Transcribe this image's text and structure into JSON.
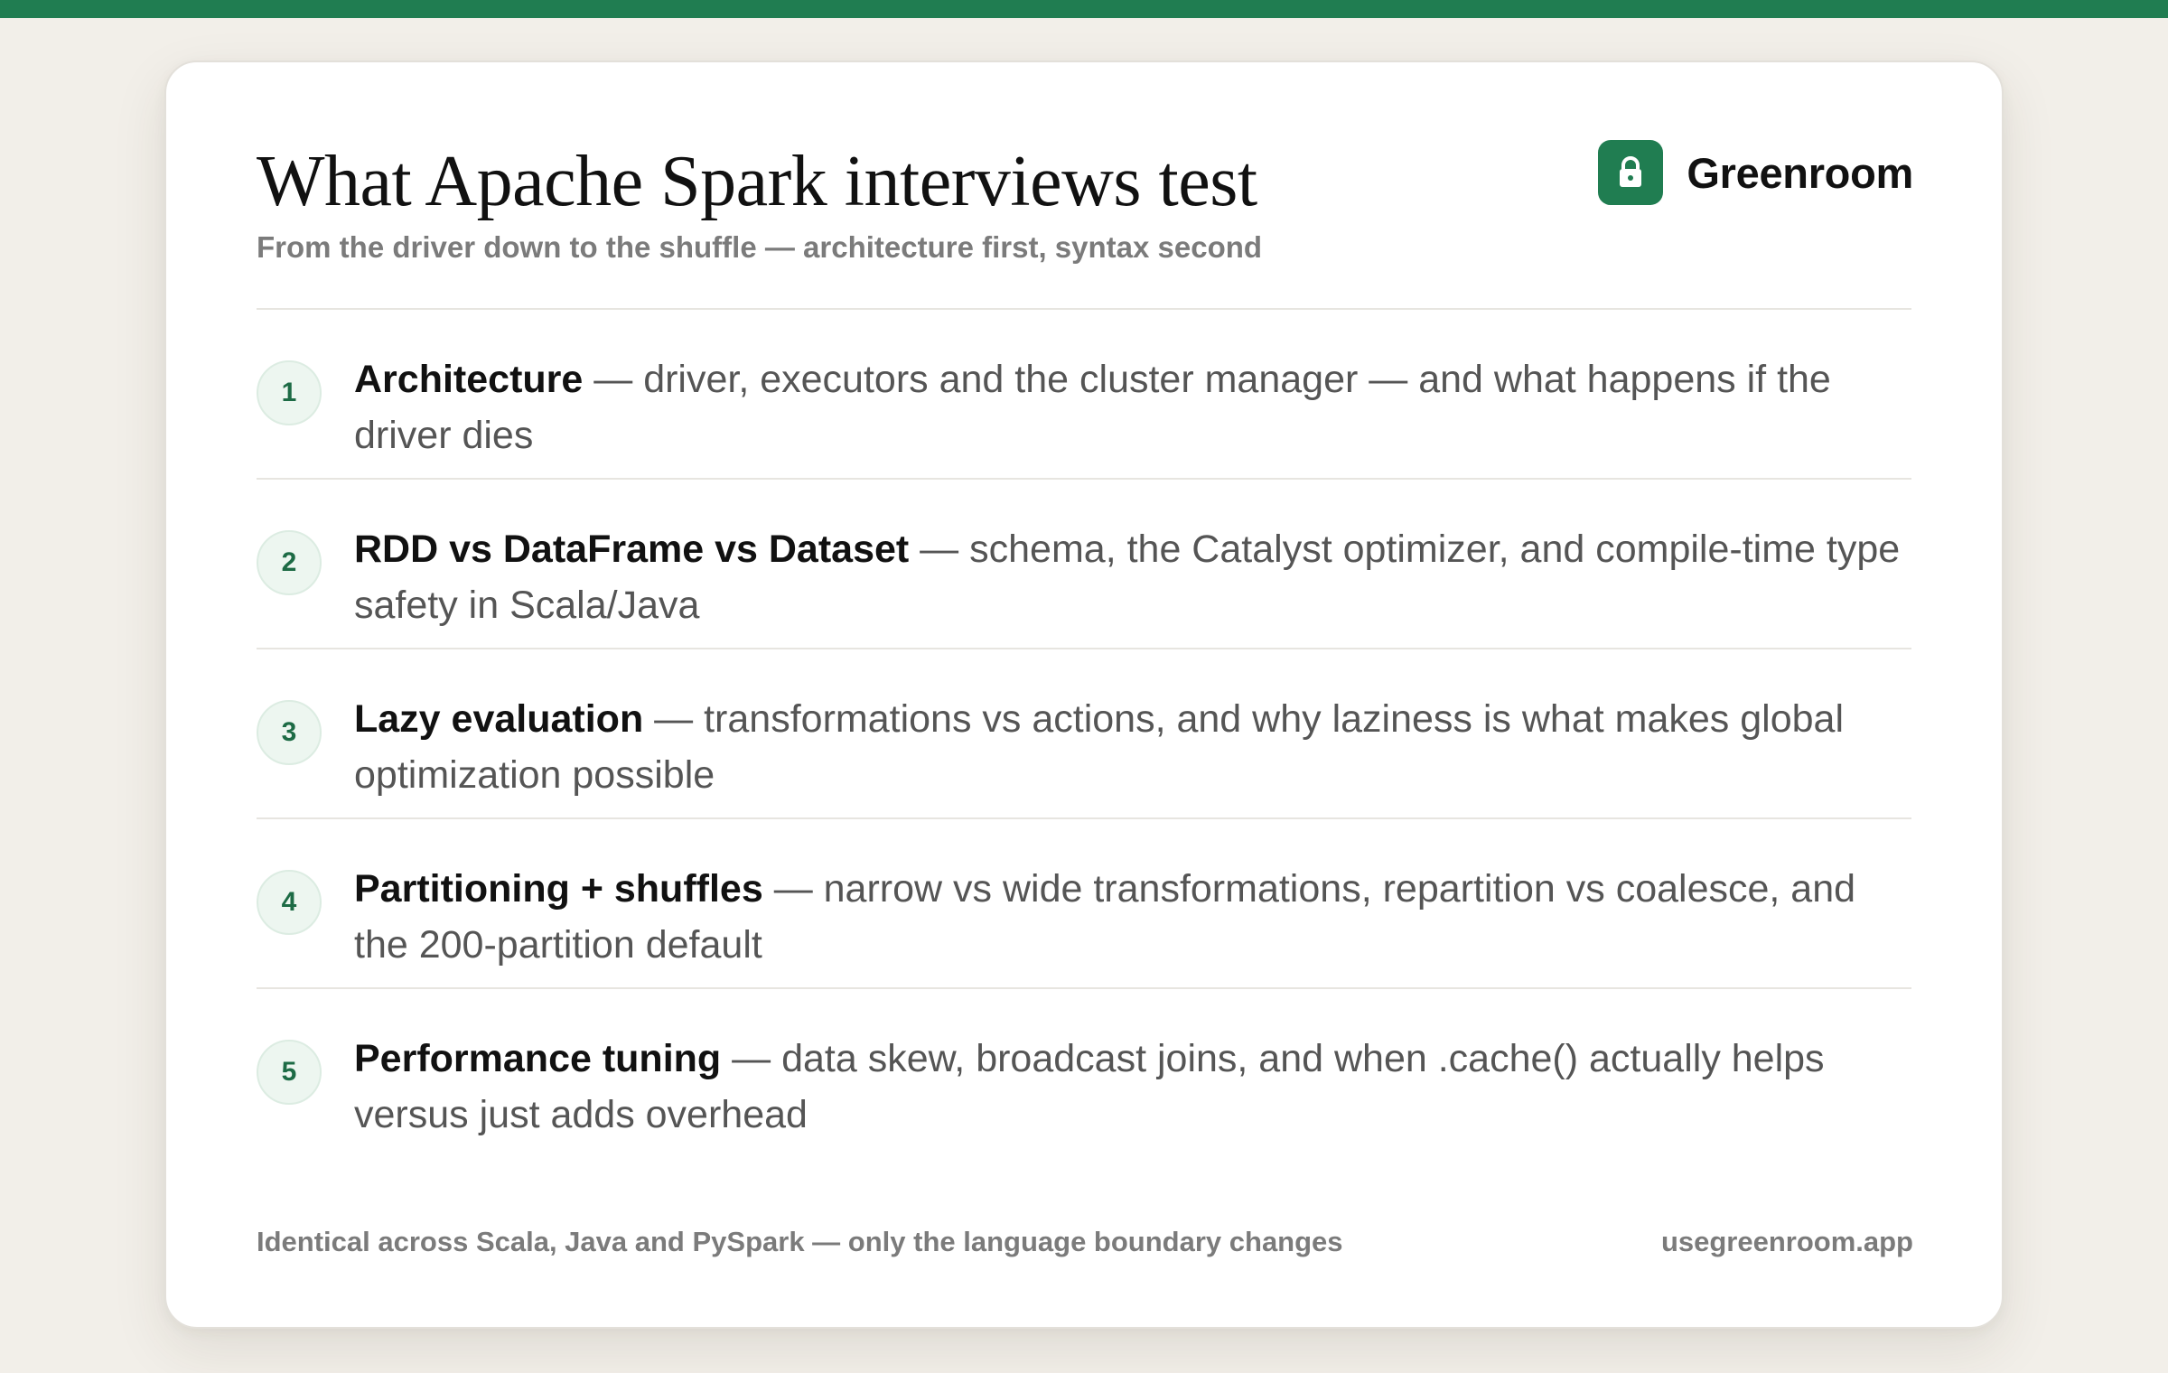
{
  "colors": {
    "accent": "#207d51",
    "background": "#f2efe9",
    "card": "#ffffff",
    "title_text": "#111111",
    "body_text": "#555555",
    "muted_text": "#7b7b7b",
    "badge_background": "#edf6f0",
    "badge_text": "#1d6b45"
  },
  "header": {
    "title": "What Apache Spark interviews test",
    "subtitle": "From the driver down to the shuffle — architecture first, syntax second"
  },
  "brand": {
    "name": "Greenroom",
    "icon": "lock-icon"
  },
  "items": [
    {
      "number": "1",
      "title": "Architecture",
      "description": " — driver, executors and the cluster manager — and what happens if the driver dies"
    },
    {
      "number": "2",
      "title": "RDD vs DataFrame vs Dataset",
      "description": " — schema, the Catalyst optimizer, and compile-time type safety in Scala/Java"
    },
    {
      "number": "3",
      "title": "Lazy evaluation",
      "description": " — transformations vs actions, and why laziness is what makes global optimization possible"
    },
    {
      "number": "4",
      "title": "Partitioning + shuffles",
      "description": " — narrow vs wide transformations, repartition vs coalesce, and the 200-partition default"
    },
    {
      "number": "5",
      "title": "Performance tuning",
      "description": " — data skew, broadcast joins, and when .cache() actually helps versus just adds overhead"
    }
  ],
  "footer": {
    "note": "Identical across Scala, Java and PySpark — only the language boundary changes",
    "url": "usegreenroom.app"
  }
}
